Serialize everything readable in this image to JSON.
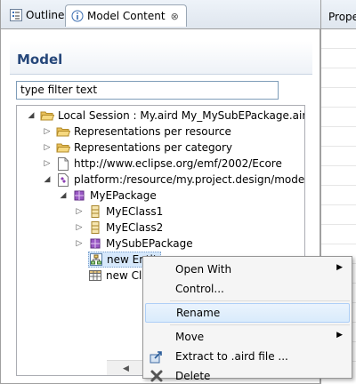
{
  "tabs": {
    "outline": "Outline",
    "model_content": "Model Content"
  },
  "right_pane": {
    "header": "Prope"
  },
  "view": {
    "title": "Model"
  },
  "filter": {
    "value": "type filter text"
  },
  "tree": {
    "session": "Local Session : My.aird  My_MySubEPackage.aird",
    "per_resource": "Representations per resource",
    "per_category": "Representations per category",
    "ecore": "http://www.eclipse.org/emf/2002/Ecore",
    "platform": "platform:/resource/my.project.design/model/My",
    "package": "MyEPackage",
    "class1": "MyEClass1",
    "class2": "MyEClass2",
    "subpackage": "MySubEPackage",
    "new_entity": "new Entit",
    "new_class": "new Cla"
  },
  "menu": {
    "open_with": "Open With",
    "control": "Control...",
    "rename": "Rename",
    "move": "Move",
    "extract": "Extract to .aird file ...",
    "delete": "Delete"
  }
}
